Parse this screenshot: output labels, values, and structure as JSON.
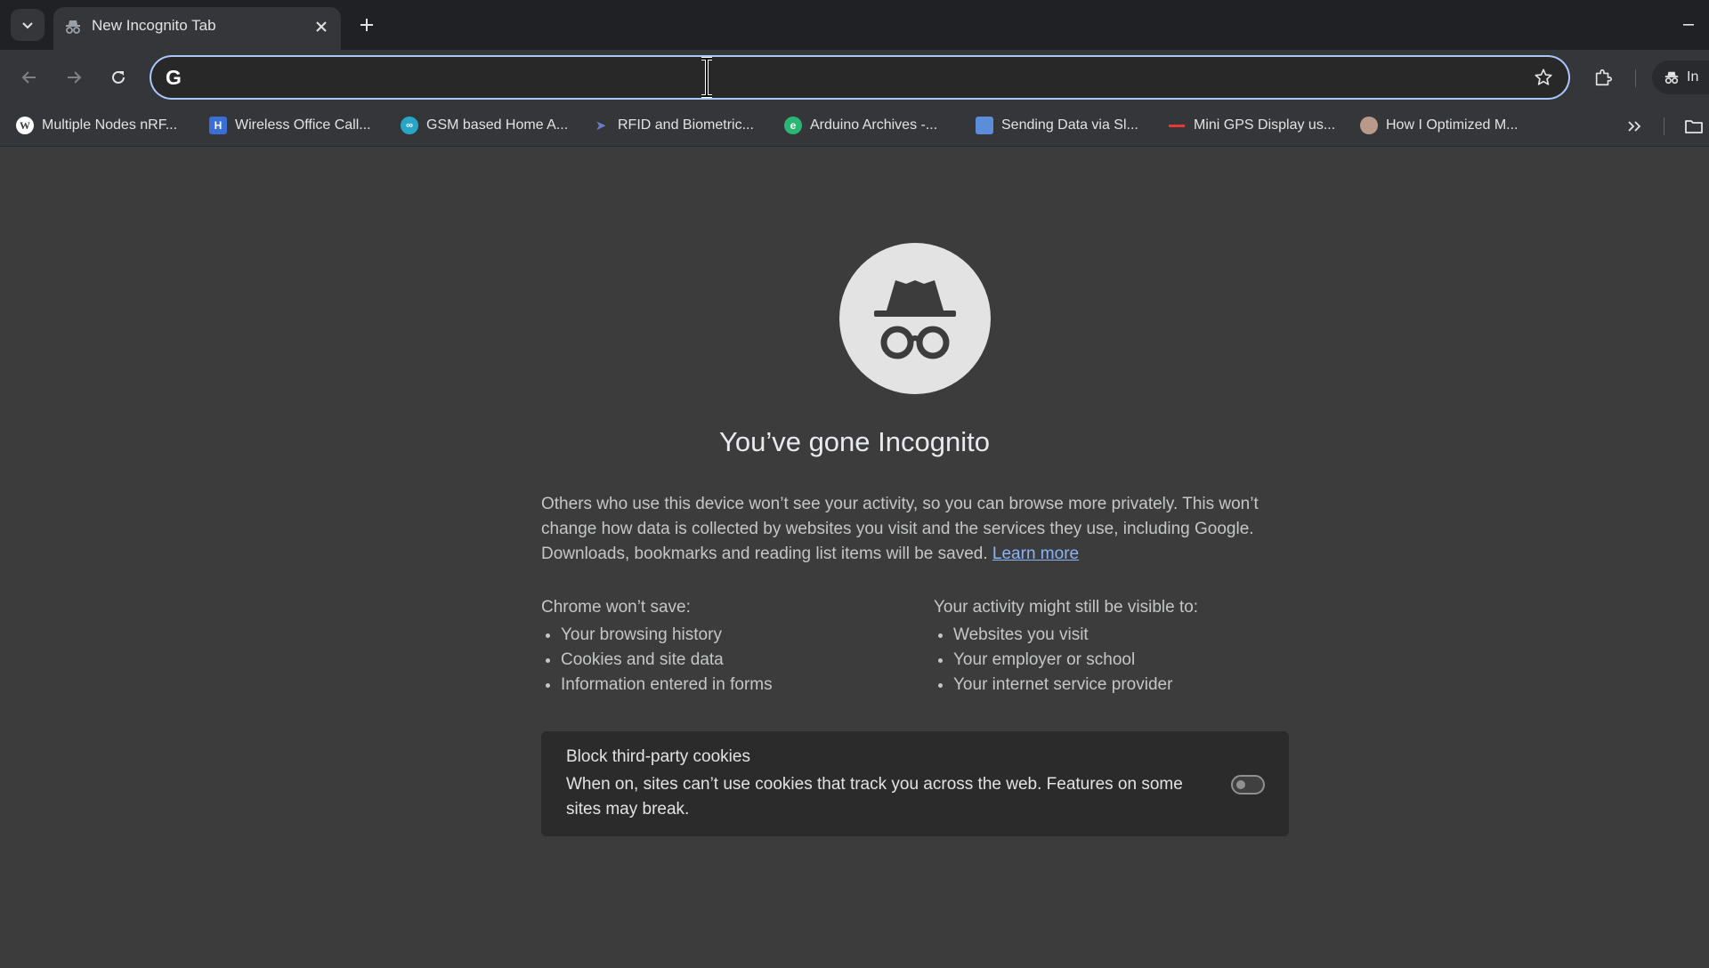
{
  "tabs": [
    {
      "title": "New Incognito Tab",
      "icon": "incognito-icon",
      "active": true
    }
  ],
  "omnibox": {
    "value": "",
    "placeholder": ""
  },
  "profile": {
    "label": "In",
    "icon": "incognito-icon"
  },
  "bookmarks": [
    {
      "label": "Multiple Nodes nRF...",
      "icon": "wordpress-icon",
      "color": "#ffffff"
    },
    {
      "label": "Wireless Office Call...",
      "icon": "h-site-icon",
      "color": "#3b6fd6"
    },
    {
      "label": "GSM based Home A...",
      "icon": "infinity-site-icon",
      "color": "#28a6c8"
    },
    {
      "label": "RFID and Biometric...",
      "icon": "arrow-site-icon",
      "color": "#6c7cc4"
    },
    {
      "label": "Arduino Archives -...",
      "icon": "e-site-icon",
      "color": "#2bb673"
    },
    {
      "label": "Sending Data via Sl...",
      "icon": "image-site-icon",
      "color": "#5b8dd9"
    },
    {
      "label": "Mini GPS Display us...",
      "icon": "red-dash-site-icon",
      "color": "#e53935"
    },
    {
      "label": "How I Optimized M...",
      "icon": "avatar-site-icon",
      "color": "#b89a8a"
    }
  ],
  "page": {
    "headline": "You’ve gone Incognito",
    "intro": "Others who use this device won’t see your activity, so you can browse more privately. This won’t change how data is collected by websites you visit and the services they use, including Google. Downloads, bookmarks and reading list items will be saved.",
    "learn_more": "Learn more",
    "wont_save": {
      "title": "Chrome won’t save:",
      "items": [
        "Your browsing history",
        "Cookies and site data",
        "Information entered in forms"
      ]
    },
    "might_be_visible": {
      "title": "Your activity might still be visible to:",
      "items": [
        "Websites you visit",
        "Your employer or school",
        "Your internet service provider"
      ]
    },
    "cookies": {
      "title": "Block third-party cookies",
      "description": "When on, sites can’t use cookies that track you across the web. Features on some sites may break.",
      "enabled": false
    }
  }
}
